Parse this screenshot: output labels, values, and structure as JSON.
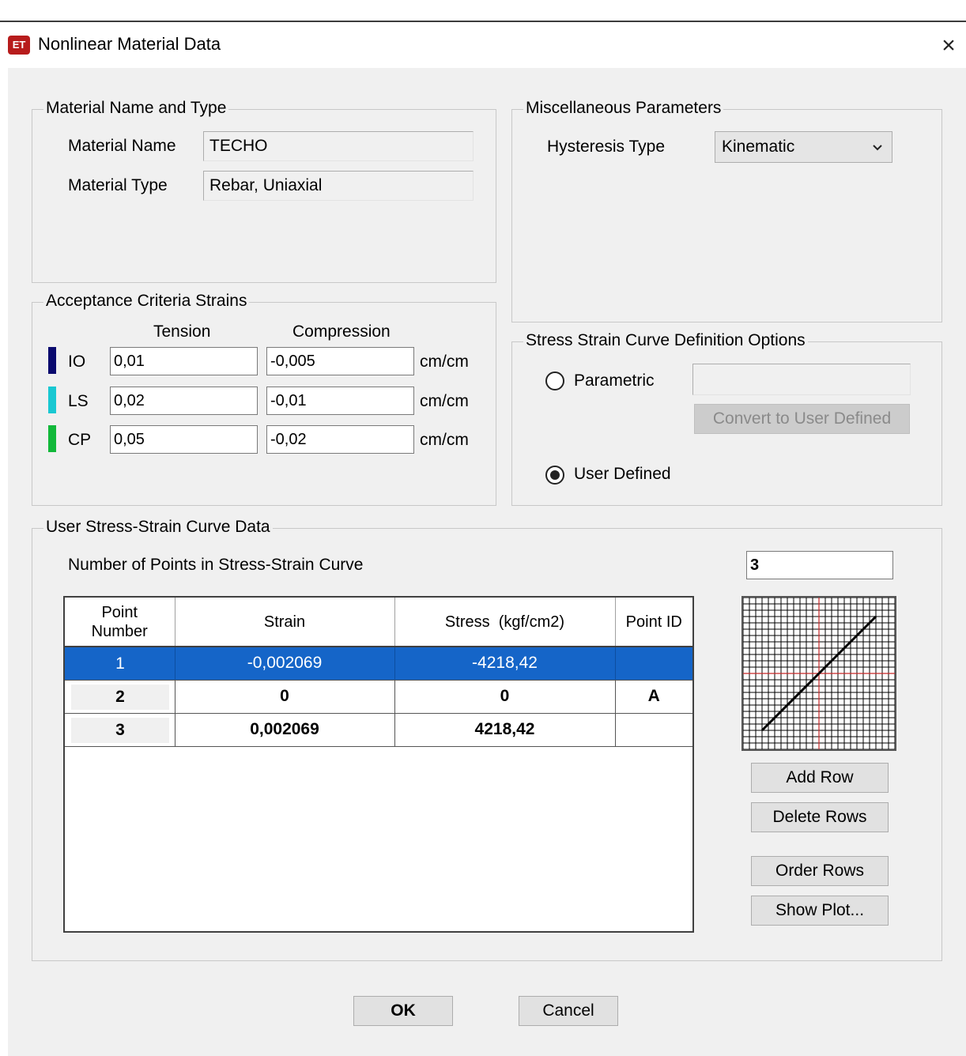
{
  "window": {
    "app_icon": "ET",
    "title": "Nonlinear Material Data",
    "close_glyph": "×"
  },
  "material": {
    "group_title": "Material Name and Type",
    "name_label": "Material Name",
    "name_value": "TECHO",
    "type_label": "Material Type",
    "type_value": "Rebar, Uniaxial"
  },
  "misc": {
    "group_title": "Miscellaneous Parameters",
    "hysteresis_label": "Hysteresis Type",
    "hysteresis_value": "Kinematic"
  },
  "acceptance": {
    "group_title": "Acceptance Criteria Strains",
    "tension_header": "Tension",
    "compression_header": "Compression",
    "rows": [
      {
        "label": "IO",
        "color": "#0a0a6e",
        "tension": "0,01",
        "compression": "-0,005",
        "unit": "cm/cm"
      },
      {
        "label": "LS",
        "color": "#19c8d2",
        "tension": "0,02",
        "compression": "-0,01",
        "unit": "cm/cm"
      },
      {
        "label": "CP",
        "color": "#12b83a",
        "tension": "0,05",
        "compression": "-0,02",
        "unit": "cm/cm"
      }
    ]
  },
  "curve_options": {
    "group_title": "Stress Strain Curve Definition Options",
    "parametric_label": "Parametric",
    "parametric_value": "",
    "convert_button": "Convert to User Defined",
    "user_defined_label": "User Defined",
    "selected": "User Defined"
  },
  "curve_data": {
    "group_title": "User Stress-Strain Curve Data",
    "num_points_label": "Number of Points in Stress-Strain Curve",
    "num_points_value": "3",
    "headers": {
      "point_number": "Point\nNumber",
      "strain": "Strain",
      "stress": "Stress  (kgf/cm2)",
      "point_id": "Point ID"
    },
    "rows": [
      {
        "point": "1",
        "strain": "-0,002069",
        "stress": "-4218,42",
        "id": "",
        "selected": true
      },
      {
        "point": "2",
        "strain": "0",
        "stress": "0",
        "id": "A",
        "selected": false
      },
      {
        "point": "3",
        "strain": "0,002069",
        "stress": "4218,42",
        "id": "",
        "selected": false
      }
    ],
    "buttons": {
      "add_row": "Add Row",
      "delete_rows": "Delete Rows",
      "order_rows": "Order Rows",
      "show_plot": "Show Plot..."
    }
  },
  "footer": {
    "ok": "OK",
    "cancel": "Cancel"
  },
  "colors": {
    "selection": "#1565c8",
    "plot_axis": "#c62828",
    "dialog_bg": "#f0f0f0"
  }
}
